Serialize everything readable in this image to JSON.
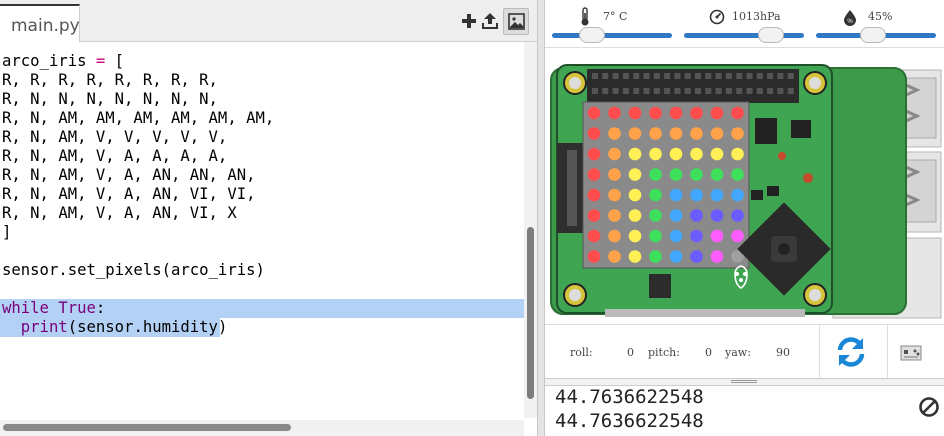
{
  "editor": {
    "tab_label": "main.py",
    "toolbar": {
      "add_icon": "plus-icon",
      "upload_icon": "upload-icon",
      "image_icon": "image-icon"
    },
    "lines": [
      {
        "t": "arco_iris = [",
        "kind": "assign"
      },
      {
        "t": "R, R, R, R, R, R, R, R,",
        "kind": "plain"
      },
      {
        "t": "R, N, N, N, N, N, N, N,",
        "kind": "plain"
      },
      {
        "t": "R, N, AM, AM, AM, AM, AM, AM,",
        "kind": "plain"
      },
      {
        "t": "R, N, AM, V, V, V, V, V,",
        "kind": "plain"
      },
      {
        "t": "R, N, AM, V, A, A, A, A,",
        "kind": "plain"
      },
      {
        "t": "R, N, AM, V, A, AN, AN, AN,",
        "kind": "plain"
      },
      {
        "t": "R, N, AM, V, A, AN, VI, VI,",
        "kind": "plain"
      },
      {
        "t": "R, N, AM, V, A, AN, VI, X",
        "kind": "plain"
      },
      {
        "t": "]",
        "kind": "plain"
      },
      {
        "t": "",
        "kind": "plain"
      },
      {
        "t": "sensor.set_pixels(arco_iris)",
        "kind": "plain"
      },
      {
        "t": "",
        "kind": "plain"
      },
      {
        "t": "while True:",
        "kind": "while"
      },
      {
        "t": "  print(sensor.humidity)",
        "kind": "print"
      }
    ]
  },
  "sensors": {
    "temperature": {
      "label": "7° C",
      "icon": "thermometer-icon",
      "level": 0.3
    },
    "pressure": {
      "label": "1013hPa",
      "icon": "gauge-icon",
      "level": 0.7
    },
    "humidity": {
      "label": "45%",
      "icon": "humidity-icon",
      "level": 0.45
    }
  },
  "readout": {
    "roll_label": "roll:",
    "roll_value": "0",
    "pitch_label": "pitch:",
    "pitch_value": "0",
    "yaw_label": "yaw:",
    "yaw_value": "90",
    "rotate_icon": "rotate-icon",
    "joystick_icon": "gamepad-icon"
  },
  "led_matrix": {
    "colors": {
      "R": "#ff4d4d",
      "N": "#ffa24a",
      "AM": "#fff056",
      "V": "#3ee05b",
      "A": "#41a7ff",
      "AN": "#6a5cff",
      "VI": "#ff5cff",
      "X": "#a0a0a0"
    },
    "grid": [
      [
        "R",
        "R",
        "R",
        "R",
        "R",
        "R",
        "R",
        "R"
      ],
      [
        "R",
        "N",
        "N",
        "N",
        "N",
        "N",
        "N",
        "N"
      ],
      [
        "R",
        "N",
        "AM",
        "AM",
        "AM",
        "AM",
        "AM",
        "AM"
      ],
      [
        "R",
        "N",
        "AM",
        "V",
        "V",
        "V",
        "V",
        "V"
      ],
      [
        "R",
        "N",
        "AM",
        "V",
        "A",
        "A",
        "A",
        "A"
      ],
      [
        "R",
        "N",
        "AM",
        "V",
        "A",
        "AN",
        "AN",
        "AN"
      ],
      [
        "R",
        "N",
        "AM",
        "V",
        "A",
        "AN",
        "VI",
        "VI"
      ],
      [
        "R",
        "N",
        "AM",
        "V",
        "A",
        "AN",
        "VI",
        "X"
      ]
    ]
  },
  "console": {
    "lines": [
      "44.7636622548",
      "44.7636622548"
    ],
    "stop_icon": "stop-icon"
  }
}
